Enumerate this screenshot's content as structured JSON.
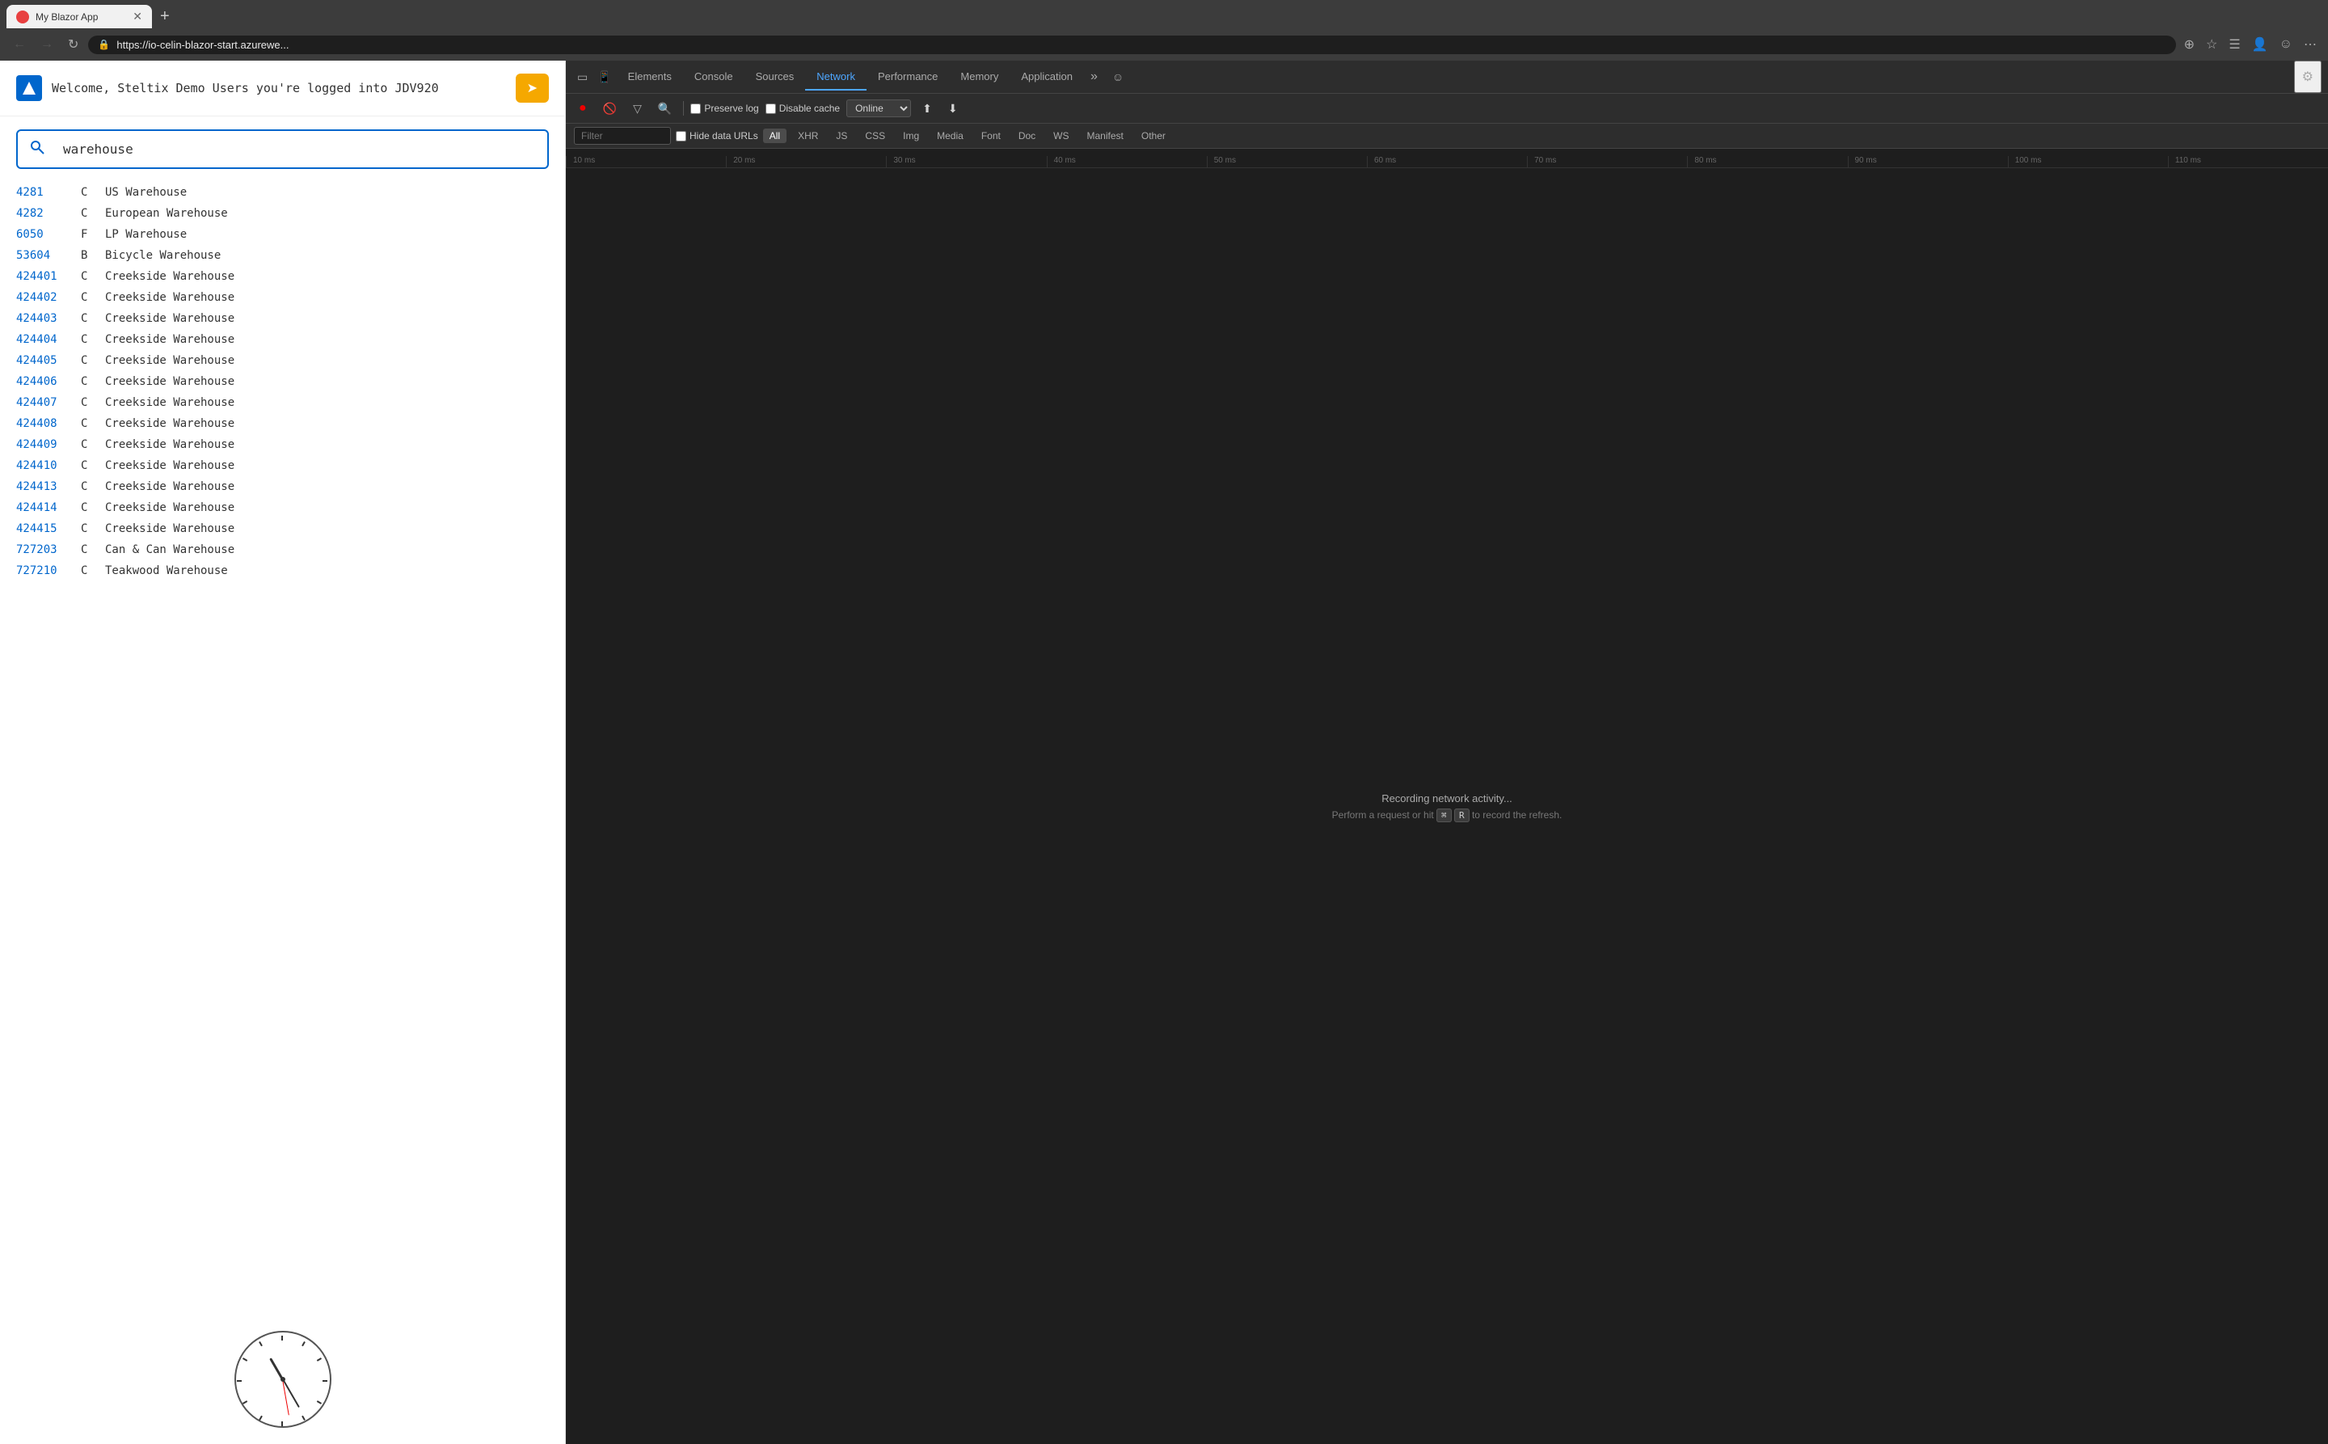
{
  "browser": {
    "tab_title": "My Blazor App",
    "tab_favicon": "B",
    "address": "https://io-celin-blazor-start.azurewe...",
    "new_tab_label": "+"
  },
  "app": {
    "welcome_text": "Welcome, Steltix Demo Users you're logged into JDV920",
    "search_placeholder": "warehouse",
    "search_value": "warehouse",
    "action_btn_label": "➤"
  },
  "warehouses": [
    {
      "id": "4281",
      "type": "C",
      "name": "US Warehouse"
    },
    {
      "id": "4282",
      "type": "C",
      "name": "European Warehouse"
    },
    {
      "id": "6050",
      "type": "F",
      "name": "LP Warehouse"
    },
    {
      "id": "53604",
      "type": "B",
      "name": "Bicycle Warehouse"
    },
    {
      "id": "424401",
      "type": "C",
      "name": "Creekside Warehouse"
    },
    {
      "id": "424402",
      "type": "C",
      "name": "Creekside Warehouse"
    },
    {
      "id": "424403",
      "type": "C",
      "name": "Creekside Warehouse"
    },
    {
      "id": "424404",
      "type": "C",
      "name": "Creekside Warehouse"
    },
    {
      "id": "424405",
      "type": "C",
      "name": "Creekside Warehouse"
    },
    {
      "id": "424406",
      "type": "C",
      "name": "Creekside Warehouse"
    },
    {
      "id": "424407",
      "type": "C",
      "name": "Creekside Warehouse"
    },
    {
      "id": "424408",
      "type": "C",
      "name": "Creekside Warehouse"
    },
    {
      "id": "424409",
      "type": "C",
      "name": "Creekside Warehouse"
    },
    {
      "id": "424410",
      "type": "C",
      "name": "Creekside Warehouse"
    },
    {
      "id": "424413",
      "type": "C",
      "name": "Creekside Warehouse"
    },
    {
      "id": "424414",
      "type": "C",
      "name": "Creekside Warehouse"
    },
    {
      "id": "424415",
      "type": "C",
      "name": "Creekside Warehouse"
    },
    {
      "id": "727203",
      "type": "C",
      "name": "Can & Can Warehouse"
    },
    {
      "id": "727210",
      "type": "C",
      "name": "Teakwood Warehouse"
    }
  ],
  "devtools": {
    "tabs": [
      "Elements",
      "Console",
      "Sources",
      "Network",
      "Performance",
      "Memory",
      "Application"
    ],
    "active_tab": "Network",
    "toolbar": {
      "record_label": "●",
      "clear_label": "🚫",
      "filter_label": "▽",
      "search_label": "🔍",
      "preserve_log_label": "Preserve log",
      "disable_cache_label": "Disable cache",
      "online_label": "Online",
      "import_label": "⬆",
      "export_label": "⬇",
      "settings_label": "⚙"
    },
    "filter_bar": {
      "placeholder": "Filter",
      "hide_data_urls": "Hide data URLs",
      "all": "All",
      "xhr": "XHR",
      "js": "JS",
      "css": "CSS",
      "img": "Img",
      "media": "Media",
      "font": "Font",
      "doc": "Doc",
      "ws": "WS",
      "manifest": "Manifest",
      "other": "Other"
    },
    "timeline_ticks": [
      "10 ms",
      "20 ms",
      "30 ms",
      "40 ms",
      "50 ms",
      "60 ms",
      "70 ms",
      "80 ms",
      "90 ms",
      "100 ms",
      "110 ms"
    ],
    "recording_text": "Recording network activity...",
    "recording_hint": "Perform a request or hit",
    "recording_hint2": "R to record the refresh.",
    "kbd_symbol": "⌘"
  }
}
